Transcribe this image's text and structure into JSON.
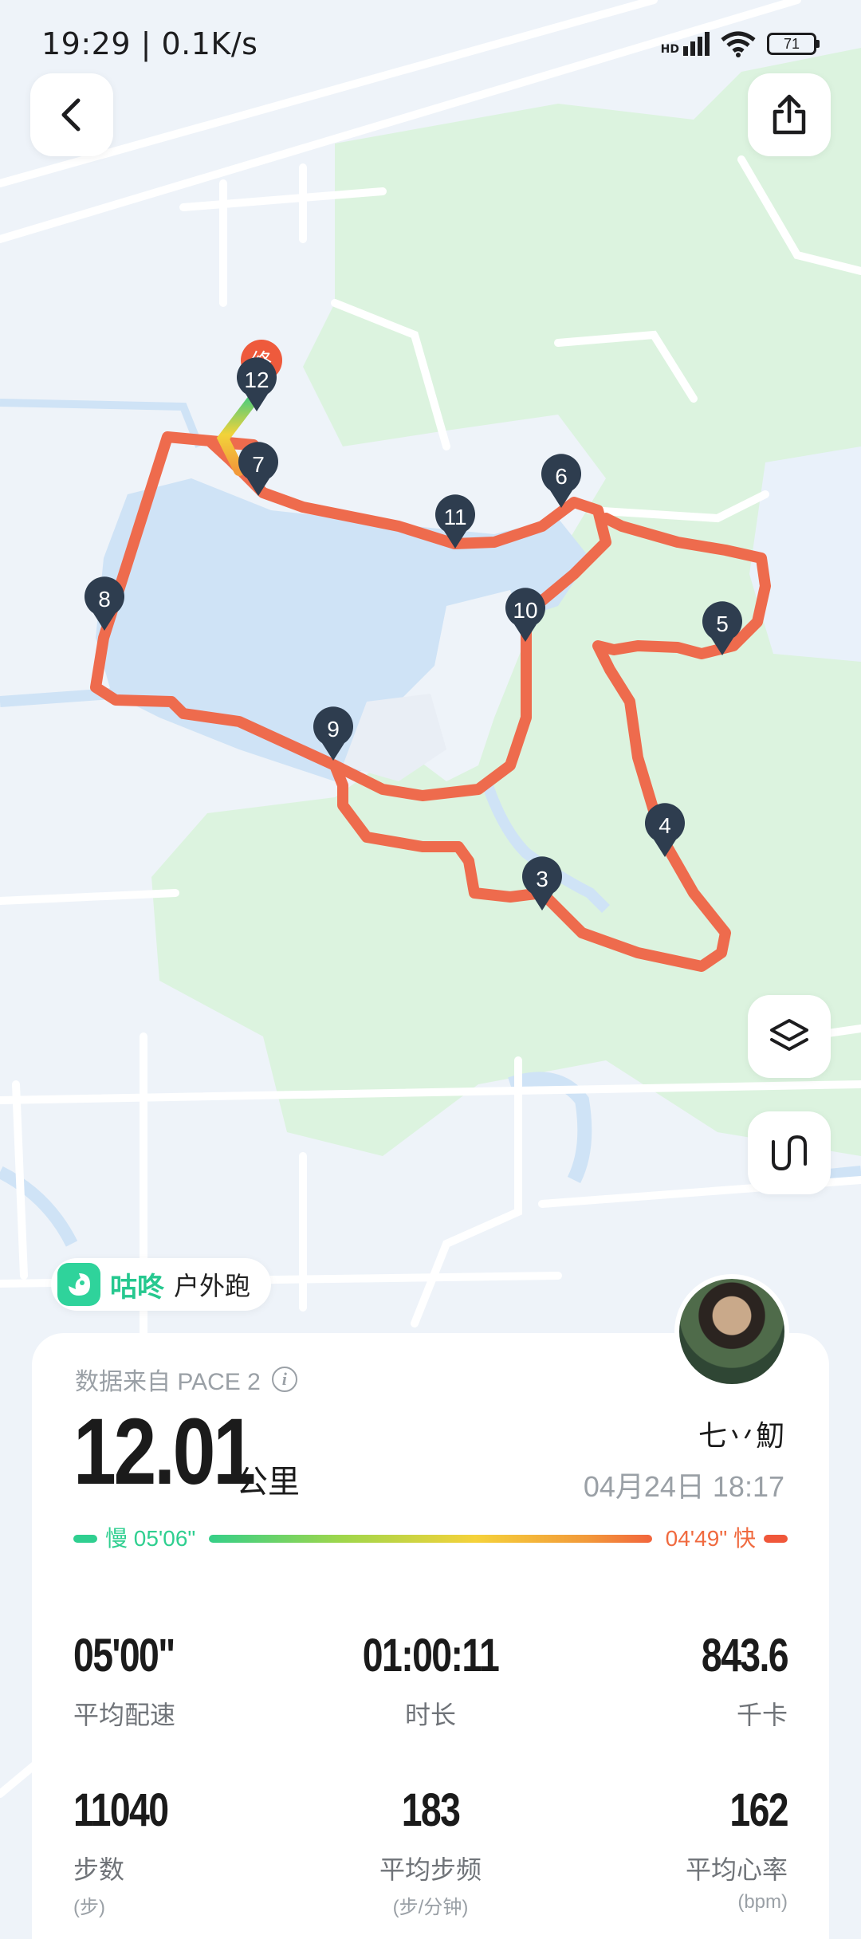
{
  "status_bar": {
    "time": "19:29 | 0.1K/s",
    "network_label": "HD",
    "battery": "71"
  },
  "map": {
    "km_markers": [
      "12",
      "7",
      "6",
      "11",
      "8",
      "10",
      "5",
      "9",
      "4",
      "3"
    ],
    "start_label": "终"
  },
  "badge": {
    "brand": "咕咚",
    "activity_type": "户外跑"
  },
  "summary": {
    "source": "数据来自 PACE 2",
    "distance": "12.01",
    "distance_unit": "公里",
    "username": "七丷魛",
    "datetime": "04月24日 18:17",
    "pace_slow": "慢 05'06\"",
    "pace_fast": "04'49\" 快"
  },
  "stats": [
    {
      "value": "05'00\"",
      "label": "平均配速",
      "unit": ""
    },
    {
      "value": "01:00:11",
      "label": "时长",
      "unit": ""
    },
    {
      "value": "843.6",
      "label": "千卡",
      "unit": ""
    },
    {
      "value": "11040",
      "label": "步数",
      "unit": "(步)"
    },
    {
      "value": "183",
      "label": "平均步频",
      "unit": "(步/分钟)"
    },
    {
      "value": "162",
      "label": "平均心率",
      "unit": "(bpm)"
    }
  ],
  "colors": {
    "route": "#ee6b4d",
    "marker": "#2e3d4f",
    "water": "#cfe3f6",
    "park": "#dcf3df",
    "accent": "#2fd39b"
  }
}
